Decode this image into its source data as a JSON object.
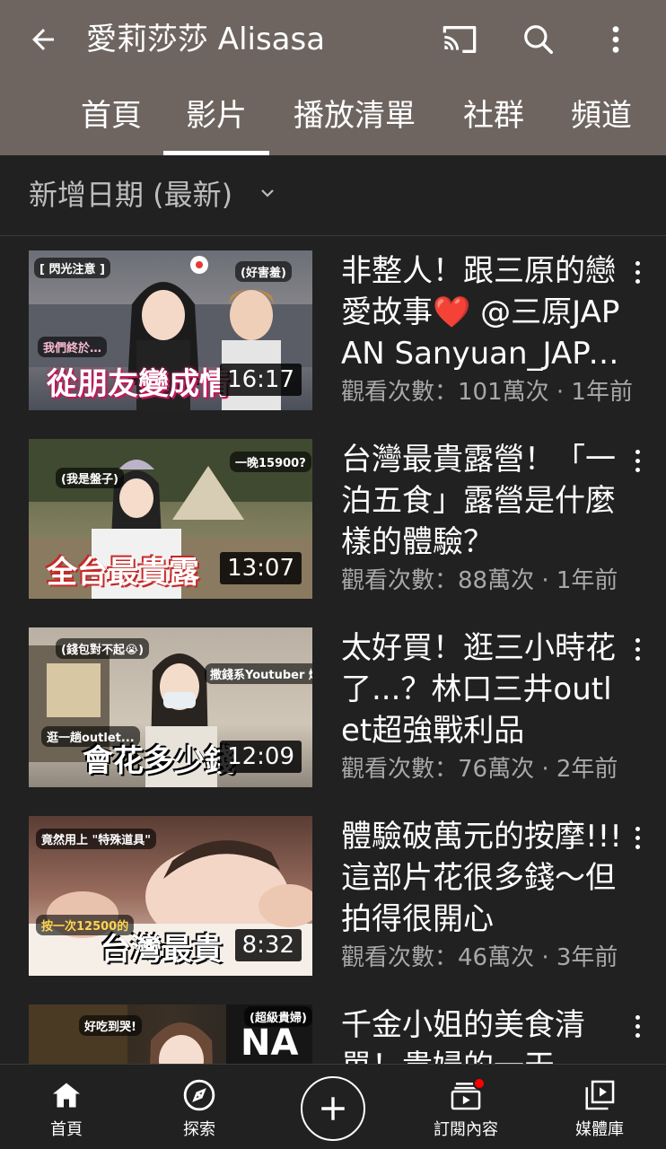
{
  "header": {
    "title": "愛莉莎莎 Alisasa"
  },
  "tabs": [
    "首頁",
    "影片",
    "播放清單",
    "社群",
    "頻道"
  ],
  "active_tab": "影片",
  "sort": {
    "label": "新增日期 (最新)"
  },
  "videos": [
    {
      "title": "非整人！跟三原的戀愛故事❤️ @三原JAPAN Sanyuan_JAPAN",
      "meta": "觀看次數：101萬次 · 1年前",
      "duration": "16:17",
      "thumb_caption": "從朋友變成情",
      "thumb_tag1": "[ 閃光注意 ]",
      "thumb_tag2": "我們終於…",
      "thumb_tag3": "(好害羞)"
    },
    {
      "title": "台灣最貴露營！「一泊五食」露營是什麼樣的體驗？",
      "meta": "觀看次數：88萬次 · 1年前",
      "duration": "13:07",
      "thumb_caption": "全台最貴露",
      "thumb_tag1": "(我是盤子)",
      "thumb_tag2": "一晚15900?",
      "thumb_tag3": ""
    },
    {
      "title": "太好買！逛三小時花了...？林口三井outlet超強戰利品",
      "meta": "觀看次數：76萬次 · 2年前",
      "duration": "12:09",
      "thumb_caption": "會花多少錢",
      "thumb_tag1": "(錢包對不起😭)",
      "thumb_tag2": "撒錢系Youtuber 爆買!",
      "thumb_tag3": "逛一趟outlet..."
    },
    {
      "title": "體驗破萬元的按摩!!!這部片花很多錢～但拍得很開心",
      "meta": "觀看次數：46萬次 · 3年前",
      "duration": "8:32",
      "thumb_caption": "台灣最貴",
      "thumb_tag1": "竟然用上 \"特殊道具\"",
      "thumb_tag2": "按一次12500的",
      "thumb_tag3": ""
    },
    {
      "title": "千金小姐的美食清單！貴婦的一天",
      "meta": "",
      "duration": "",
      "thumb_caption": "",
      "thumb_tag1": "好吃到哭!",
      "thumb_tag2": "(超級貴婦)",
      "thumb_tag3": ""
    }
  ],
  "bottom_nav": [
    {
      "label": "首頁",
      "icon": "home-icon"
    },
    {
      "label": "探索",
      "icon": "explore-icon"
    },
    {
      "label": "",
      "icon": "create-icon"
    },
    {
      "label": "訂閱內容",
      "icon": "subscriptions-icon"
    },
    {
      "label": "媒體庫",
      "icon": "library-icon"
    }
  ],
  "colors": {
    "appbar": "#6e6561",
    "background": "#212121",
    "badge": "#ff0000"
  }
}
